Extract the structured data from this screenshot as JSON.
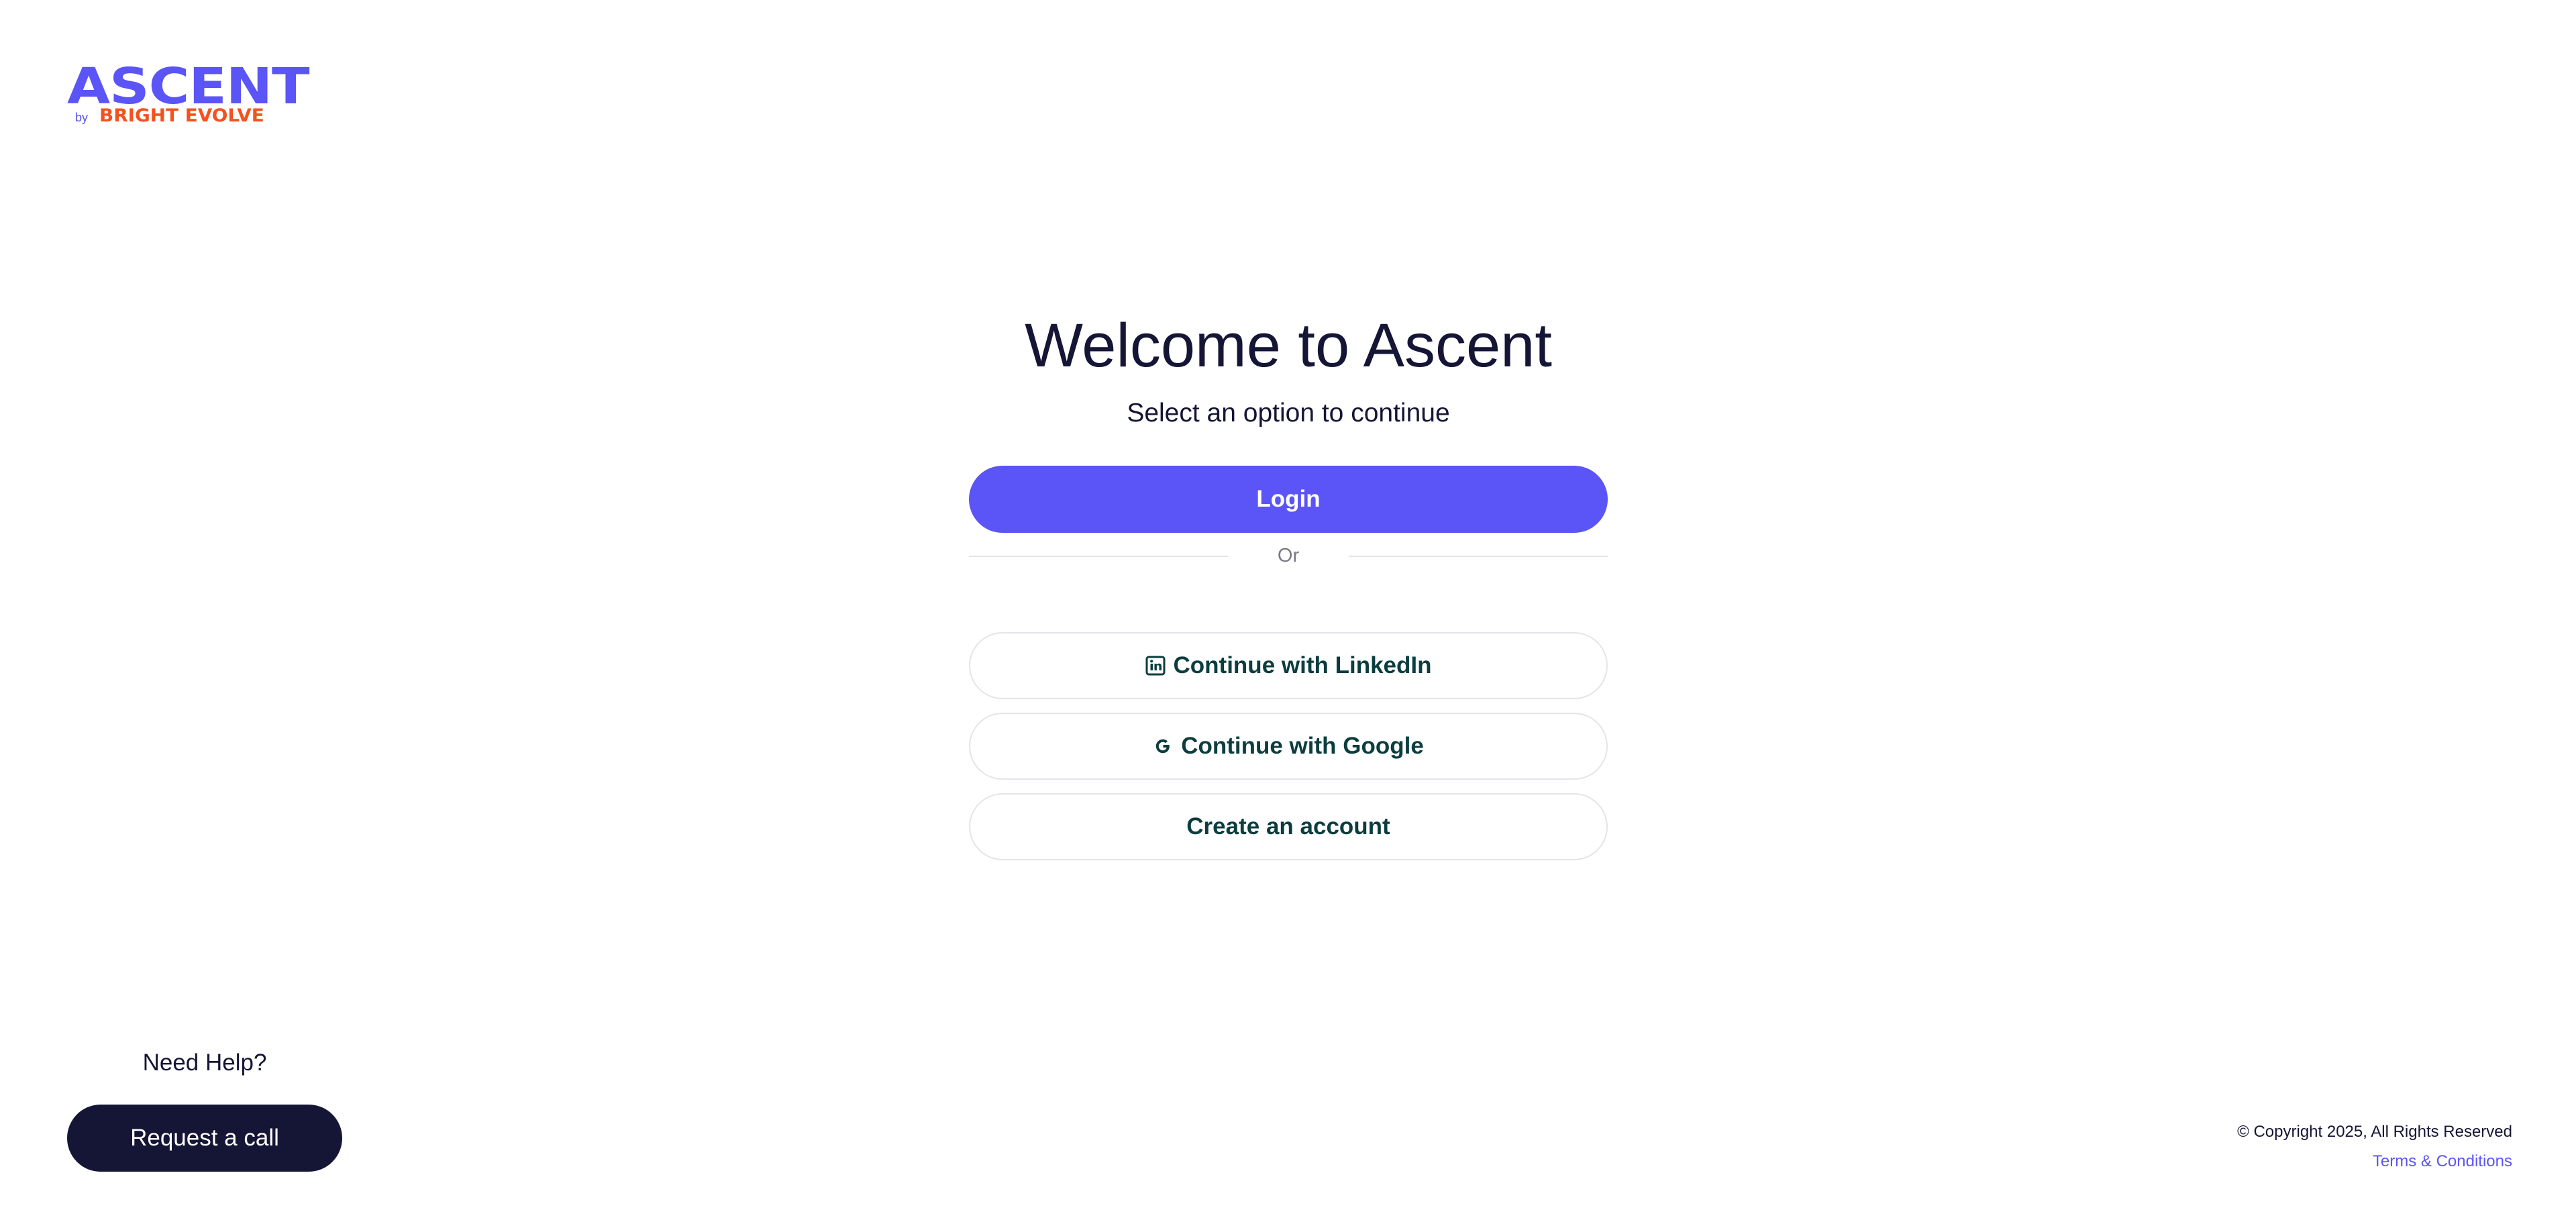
{
  "logo": {
    "wordmark": "ASCENT",
    "by": "by",
    "brand": "BRIGHT EVOLVE",
    "colors": {
      "wordmark": "#5b54f7",
      "brand": "#f4511e"
    }
  },
  "main": {
    "title": "Welcome to Ascent",
    "subtitle": "Select an option to continue",
    "login_label": "Login",
    "divider_label": "Or",
    "linkedin_label": "Continue with LinkedIn",
    "linkedin_icon": "linkedin-icon",
    "google_label": "Continue with Google",
    "google_icon": "google-icon",
    "create_label": "Create an account"
  },
  "help": {
    "label": "Need Help?",
    "button_label": "Request a call"
  },
  "footer": {
    "copyright": "© Copyright 2025, All Rights Reserved",
    "terms": "Terms & Conditions"
  },
  "colors": {
    "primary": "#5b54f7",
    "dark": "#151536",
    "outline_text": "#0c3d3f",
    "border": "#e4e4ea"
  }
}
